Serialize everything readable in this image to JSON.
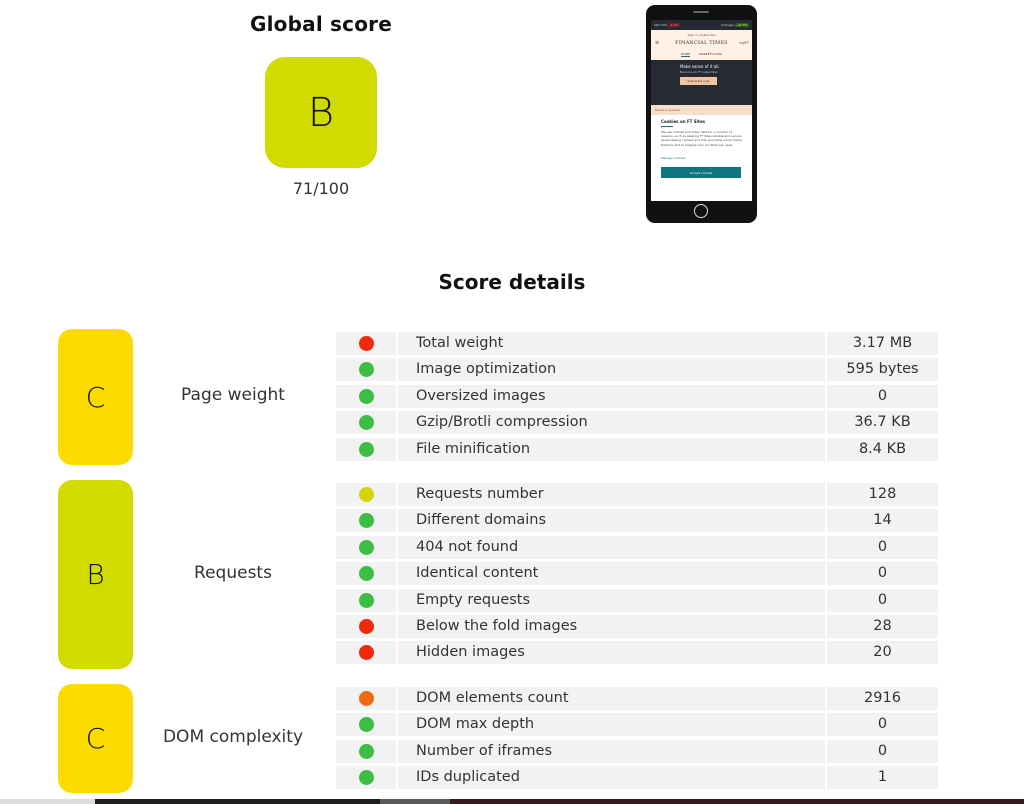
{
  "global": {
    "title": "Global score",
    "grade": "B",
    "score": "71/100",
    "color": "#d1db00"
  },
  "preview": {
    "status_left": "S&P 500",
    "status_left_badge": "-1.5%",
    "status_right": "Changes",
    "status_right_badge": "+0.7%",
    "sign_links": "Sign in   |   Subscribe",
    "brand": "FINANCIAL TIMES",
    "myft": "myFT",
    "tabs": [
      "HOME",
      "MARKETS DATA"
    ],
    "promo_title": "Make sense of it all.",
    "promo_sub": "Become an FT subscriber",
    "promo_button": "Subscribe now",
    "back_link": "Banks in turmoil",
    "cookie_title": "Cookies on FT Sites",
    "cookie_body": "We use cookies and other data for a number of reasons, such as keeping FT Sites reliable and secure, personalising content and ads, providing social media features and to analyse how our Sites are used.",
    "manage_link": "Manage cookies",
    "accept_button": "Accept cookies"
  },
  "details": {
    "title": "Score details",
    "status_colors": {
      "red": "#f0290c",
      "green": "#3dbd44",
      "yellow": "#d4d40a",
      "orange": "#ee6a13"
    },
    "categories": [
      {
        "grade": "C",
        "label": "Page weight",
        "color": "#fddb00",
        "metrics": [
          {
            "status": "red",
            "name": "Total weight",
            "value": "3.17 MB"
          },
          {
            "status": "green",
            "name": "Image optimization",
            "value": "595 bytes"
          },
          {
            "status": "green",
            "name": "Oversized images",
            "value": "0"
          },
          {
            "status": "green",
            "name": "Gzip/Brotli compression",
            "value": "36.7 KB"
          },
          {
            "status": "green",
            "name": "File minification",
            "value": "8.4 KB"
          }
        ]
      },
      {
        "grade": "B",
        "label": "Requests",
        "color": "#d1db00",
        "metrics": [
          {
            "status": "yellow",
            "name": "Requests number",
            "value": "128"
          },
          {
            "status": "green",
            "name": "Different domains",
            "value": "14"
          },
          {
            "status": "green",
            "name": "404 not found",
            "value": "0"
          },
          {
            "status": "green",
            "name": "Identical content",
            "value": "0"
          },
          {
            "status": "green",
            "name": "Empty requests",
            "value": "0"
          },
          {
            "status": "red",
            "name": "Below the fold images",
            "value": "28"
          },
          {
            "status": "red",
            "name": "Hidden images",
            "value": "20"
          }
        ]
      },
      {
        "grade": "C",
        "label": "DOM complexity",
        "color": "#fddb00",
        "metrics": [
          {
            "status": "orange",
            "name": "DOM elements count",
            "value": "2916"
          },
          {
            "status": "green",
            "name": "DOM max depth",
            "value": "0"
          },
          {
            "status": "green",
            "name": "Number of iframes",
            "value": "0"
          },
          {
            "status": "green",
            "name": "IDs duplicated",
            "value": "1"
          }
        ]
      }
    ]
  }
}
